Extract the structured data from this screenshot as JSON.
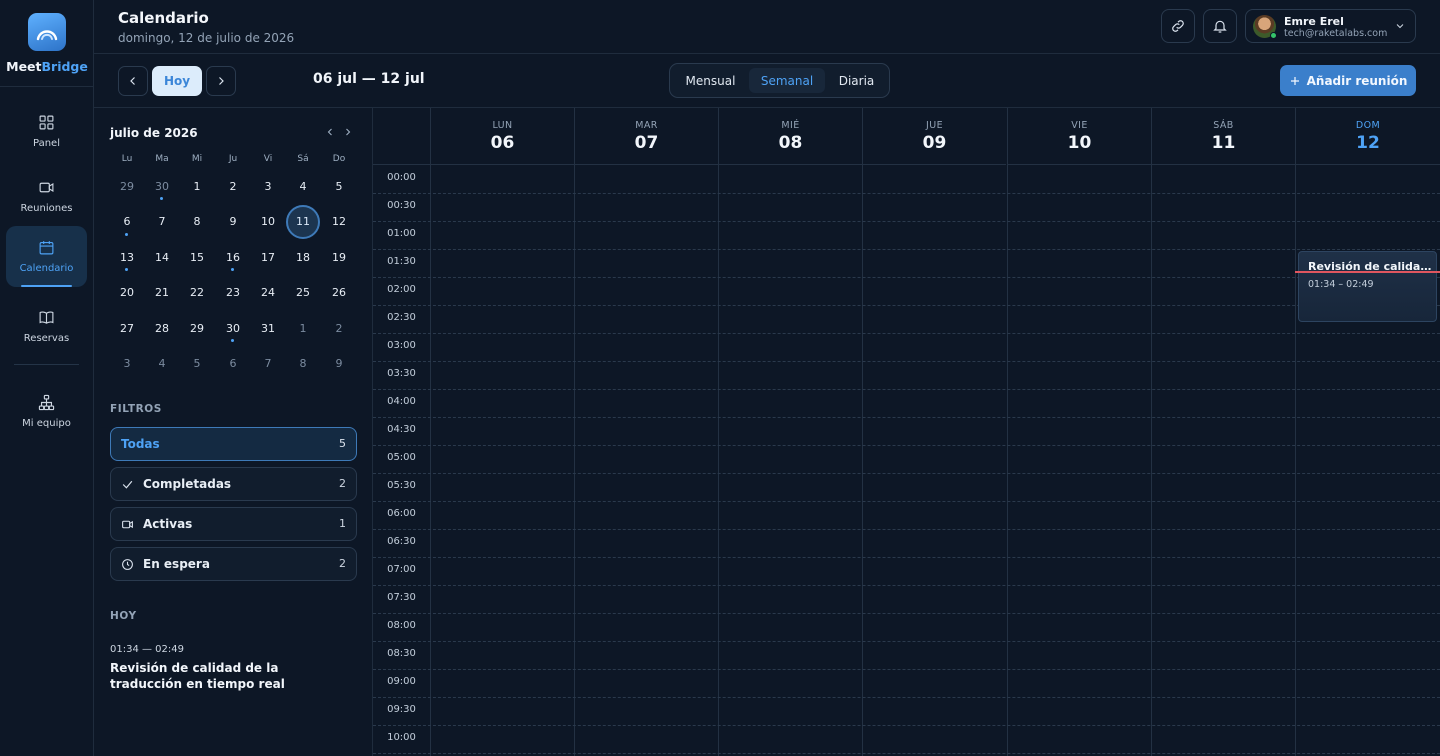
{
  "app": {
    "brand_part1": "Meet",
    "brand_part2": "Bridge"
  },
  "nav": [
    {
      "label": "Panel",
      "icon": "grid-icon"
    },
    {
      "label": "Reuniones",
      "icon": "video-icon"
    },
    {
      "label": "Calendario",
      "icon": "calendar-icon",
      "active": true
    },
    {
      "label": "Reservas",
      "icon": "book-icon"
    },
    {
      "label": "Mi equipo",
      "icon": "org-chart-icon"
    }
  ],
  "header": {
    "title": "Calendario",
    "subtitle": "domingo, 12 de julio de 2026",
    "user": {
      "name": "Emre Erel",
      "email": "tech@raketalabs.com"
    }
  },
  "toolbar": {
    "today": "Hoy",
    "range": "06 jul — 12 jul",
    "views": [
      "Mensual",
      "Semanal",
      "Diaria"
    ],
    "active_view": "Semanal",
    "add_button": "Añadir reunión"
  },
  "mini_calendar": {
    "title": "julio de 2026",
    "weekdays": [
      "Lu",
      "Ma",
      "Mi",
      "Ju",
      "Vi",
      "Sá",
      "Do"
    ],
    "weeks": [
      [
        "29",
        "30",
        "1",
        "2",
        "3",
        "4",
        "5"
      ],
      [
        "6",
        "7",
        "8",
        "9",
        "10",
        "11",
        "12"
      ],
      [
        "13",
        "14",
        "15",
        "16",
        "17",
        "18",
        "19"
      ],
      [
        "20",
        "21",
        "22",
        "23",
        "24",
        "25",
        "26"
      ],
      [
        "27",
        "28",
        "29",
        "30",
        "31",
        "1",
        "2"
      ],
      [
        "3",
        "4",
        "5",
        "6",
        "7",
        "8",
        "9"
      ]
    ],
    "selected": "11",
    "event_days": [
      "30",
      "6",
      "13",
      "16"
    ]
  },
  "filters": {
    "label": "FILTROS",
    "items": [
      {
        "label": "Todas",
        "count": "5",
        "icon": "",
        "active": true
      },
      {
        "label": "Completadas",
        "count": "2",
        "icon": "check-icon"
      },
      {
        "label": "Activas",
        "count": "1",
        "icon": "video-icon"
      },
      {
        "label": "En espera",
        "count": "2",
        "icon": "clock-icon"
      }
    ]
  },
  "today_panel": {
    "label": "HOY",
    "time": "01:34 — 02:49",
    "title": "Revisión de calidad de la traducción en tiempo real"
  },
  "week": {
    "days": [
      {
        "dow": "LUN",
        "num": "06"
      },
      {
        "dow": "MAR",
        "num": "07"
      },
      {
        "dow": "MIÉ",
        "num": "08"
      },
      {
        "dow": "JUE",
        "num": "09"
      },
      {
        "dow": "VIE",
        "num": "10"
      },
      {
        "dow": "SÁB",
        "num": "11"
      },
      {
        "dow": "DOM",
        "num": "12",
        "today": true
      }
    ],
    "times": [
      "00:00",
      "00:30",
      "01:00",
      "01:30",
      "02:00",
      "02:30",
      "03:00",
      "03:30",
      "04:00",
      "04:30",
      "05:00",
      "05:30",
      "06:00",
      "06:30",
      "07:00",
      "07:30",
      "08:00",
      "08:30",
      "09:00",
      "09:30",
      "10:00"
    ],
    "event": {
      "title": "Revisión de calidad de la traducción en tiempo real",
      "time": "01:34 – 02:49"
    }
  },
  "colors": {
    "accent": "#4ea2f5",
    "background": "#0d1726",
    "now_line": "#e0565f"
  }
}
